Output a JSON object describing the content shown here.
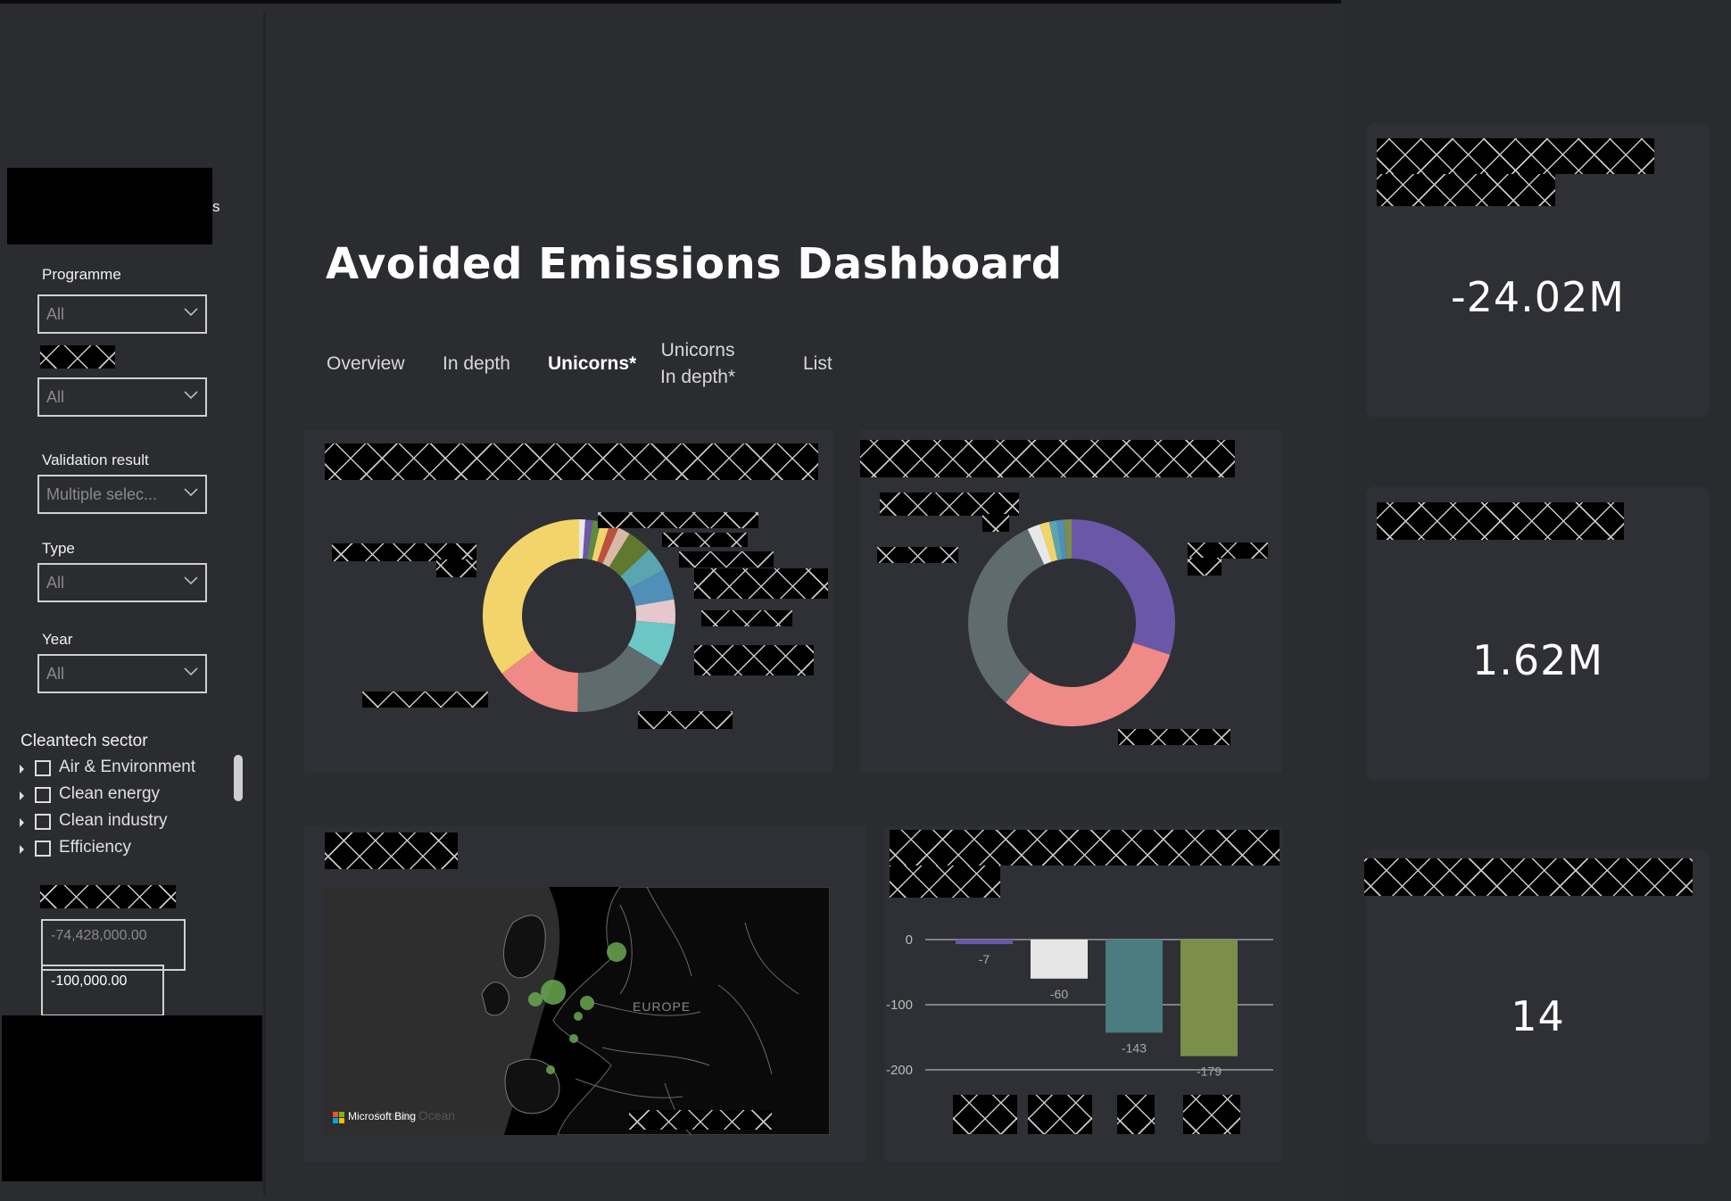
{
  "header": {
    "title": "Avoided Emissions Dashboard",
    "tabs": [
      {
        "label": "Overview"
      },
      {
        "label": "In depth"
      },
      {
        "label": "Unicorns*"
      },
      {
        "label": "Unicorns\nIn depth*"
      },
      {
        "label": "List"
      }
    ],
    "active_tab": "Unicorns*"
  },
  "sidebar": {
    "partial_heading": "s",
    "filters": [
      {
        "label": "Programme",
        "value": "All"
      },
      {
        "label": "",
        "value": "All"
      },
      {
        "label": "Validation result",
        "value": "Multiple selec..."
      },
      {
        "label": "Type",
        "value": "All"
      },
      {
        "label": "Year",
        "value": "All"
      }
    ],
    "sector_title": "Cleantech sector",
    "sectors": [
      "Air & Environment",
      "Clean energy",
      "Clean industry",
      "Efficiency"
    ],
    "range": {
      "min": "-74,428,000.00",
      "max": "-100,000.00"
    }
  },
  "kpis": [
    {
      "value": "-24.02M"
    },
    {
      "value": "1.62M"
    },
    {
      "value": "14"
    }
  ],
  "map": {
    "region_label": "EUROPE",
    "ocean_label": "Atlantic Ocean",
    "attribution": "Microsoft Bing"
  },
  "colors": {
    "accent_yellow": "#f2d46b",
    "accent_salmon": "#ef8a86",
    "accent_slate": "#5f6b6d",
    "accent_purple": "#6b57a8",
    "accent_teal": "#4a7c80",
    "accent_olive": "#7b8f4a",
    "map_point": "#6aa84f"
  },
  "chart_data": [
    {
      "type": "pie",
      "title": "",
      "donut": true,
      "labels_visible": false,
      "slices": [
        {
          "value": 34,
          "color": "#f2d46b"
        },
        {
          "value": 14,
          "color": "#ef8a86"
        },
        {
          "value": 16,
          "color": "#5f6b6d"
        },
        {
          "value": 7,
          "color": "#6cc6c4"
        },
        {
          "value": 4,
          "color": "#e6c8cc"
        },
        {
          "value": 5,
          "color": "#4f8fb8"
        },
        {
          "value": 4,
          "color": "#5aa5b0"
        },
        {
          "value": 4,
          "color": "#5f7a2f"
        },
        {
          "value": 2,
          "color": "#d8b9a8"
        },
        {
          "value": 1.5,
          "color": "#c0503e"
        },
        {
          "value": 1.5,
          "color": "#f2d46b"
        },
        {
          "value": 1.3,
          "color": "#5f8a3f"
        },
        {
          "value": 1.2,
          "color": "#6b57a8"
        },
        {
          "value": 1,
          "color": "#e8e8e8"
        }
      ]
    },
    {
      "type": "pie",
      "title": "",
      "donut": true,
      "labels_visible": false,
      "slices": [
        {
          "value": 30,
          "color": "#6b57a8"
        },
        {
          "value": 31,
          "color": "#ef8a86"
        },
        {
          "value": 32,
          "color": "#5f6b6d"
        },
        {
          "value": 2,
          "color": "#e8e8e8"
        },
        {
          "value": 1.5,
          "color": "#f2d46b"
        },
        {
          "value": 1.2,
          "color": "#5aa5b0"
        },
        {
          "value": 1.1,
          "color": "#4f8fb8"
        },
        {
          "value": 1.2,
          "color": "#7b8f4a"
        }
      ]
    },
    {
      "type": "bar",
      "title": "",
      "categories": [
        "",
        "",
        "",
        ""
      ],
      "values": [
        -7,
        -60,
        -143,
        -179
      ],
      "colors": [
        "#6b57a8",
        "#e6e6e6",
        "#4a7c80",
        "#7b8f4a"
      ],
      "y_ticks": [
        0,
        -100,
        -200
      ],
      "ylim": [
        -200,
        0
      ],
      "grid": true
    }
  ]
}
